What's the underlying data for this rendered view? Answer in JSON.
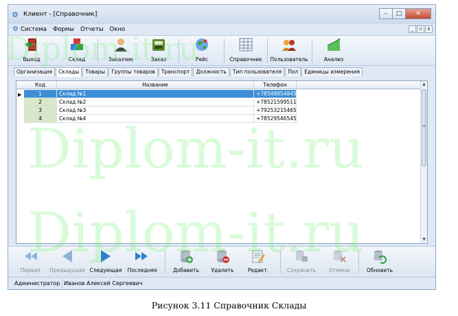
{
  "window": {
    "title": "Клиент - [Справочник]",
    "app_icon": "gear-icon"
  },
  "menu": {
    "items": [
      "Система",
      "Формы",
      "Отчеты",
      "Окно"
    ]
  },
  "toolbar": {
    "buttons": [
      {
        "label": "Выход",
        "icon": "exit-door-icon"
      },
      {
        "label": "Склад",
        "icon": "warehouse-boxes-icon"
      },
      {
        "label": "Заказчик",
        "icon": "customer-person-icon"
      },
      {
        "label": "Заказ",
        "icon": "order-cash-register-icon"
      },
      {
        "label": "Рейс",
        "icon": "globe-route-icon"
      },
      {
        "label": "Справочник",
        "icon": "reference-table-icon"
      },
      {
        "label": "Пользователь",
        "icon": "users-group-icon"
      },
      {
        "label": "Анализ",
        "icon": "analysis-chart-icon"
      }
    ]
  },
  "tabs": [
    {
      "label": "Организация",
      "active": false
    },
    {
      "label": "Склады",
      "active": true
    },
    {
      "label": "Товары",
      "active": false
    },
    {
      "label": "Группы товаров",
      "active": false
    },
    {
      "label": "Транспорт",
      "active": false
    },
    {
      "label": "Должность",
      "active": false
    },
    {
      "label": "Тип пользователя",
      "active": false
    },
    {
      "label": "Пол",
      "active": false
    },
    {
      "label": "Единицы измерения",
      "active": false
    }
  ],
  "grid": {
    "columns": [
      "Код",
      "Название",
      "Телефон"
    ],
    "rows": [
      {
        "code": "1",
        "name": "Склад №1",
        "phone": "+78548954845",
        "selected": true
      },
      {
        "code": "2",
        "name": "Склад №2",
        "phone": "+78521599511",
        "selected": false
      },
      {
        "code": "3",
        "name": "Склад №3",
        "phone": "+79253215465",
        "selected": false
      },
      {
        "code": "4",
        "name": "Склад №4",
        "phone": "+78529546545",
        "selected": false
      }
    ]
  },
  "navigator": {
    "buttons": [
      {
        "label": "Первая",
        "icon": "first-record-icon",
        "enabled": false
      },
      {
        "label": "Предыдущая",
        "icon": "prev-record-icon",
        "enabled": false
      },
      {
        "label": "Следующая",
        "icon": "next-record-icon",
        "enabled": true
      },
      {
        "label": "Последняя",
        "icon": "last-record-icon",
        "enabled": true
      },
      {
        "label": "Добавить",
        "icon": "add-record-icon",
        "enabled": true
      },
      {
        "label": "Удалить",
        "icon": "delete-record-icon",
        "enabled": true
      },
      {
        "label": "Редакт.",
        "icon": "edit-record-icon",
        "enabled": true
      },
      {
        "label": "Сохранить",
        "icon": "save-record-icon",
        "enabled": false
      },
      {
        "label": "Отмена",
        "icon": "cancel-record-icon",
        "enabled": false
      },
      {
        "label": "Обновить",
        "icon": "refresh-icon",
        "enabled": true
      }
    ]
  },
  "status": {
    "role": "Администратор",
    "user": "Иванов Алексей Сергеевич"
  },
  "caption": "Рисунок 3.11 Справочник Склады",
  "watermark": "Diplom-it.ru",
  "colors": {
    "selected_row": "#3b8ed6",
    "code_cell": "#d8e8c8",
    "watermark": "#78f078"
  }
}
